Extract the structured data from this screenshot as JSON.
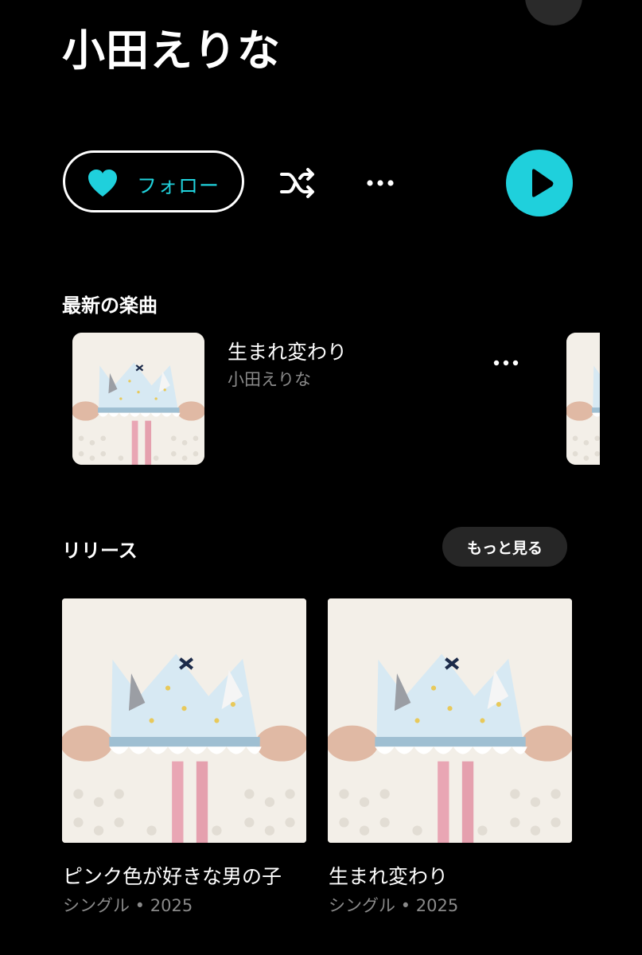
{
  "header": {
    "artist_name": "小田えりな"
  },
  "actions": {
    "follow_label": "フォロー",
    "accent_color": "#1fd0dc",
    "icons": [
      "heart-icon",
      "shuffle-icon",
      "more-horizontal-icon",
      "play-icon"
    ]
  },
  "latest": {
    "title": "最新の楽曲",
    "song": {
      "title": "生まれ変わり",
      "artist": "小田えりな"
    }
  },
  "releases": {
    "title": "リリース",
    "more_label": "もっと見る",
    "items": [
      {
        "title": "ピンク色が好きな男の子",
        "meta": "シングル • 2025"
      },
      {
        "title": "生まれ変わり",
        "meta": "シングル • 2025"
      }
    ]
  }
}
